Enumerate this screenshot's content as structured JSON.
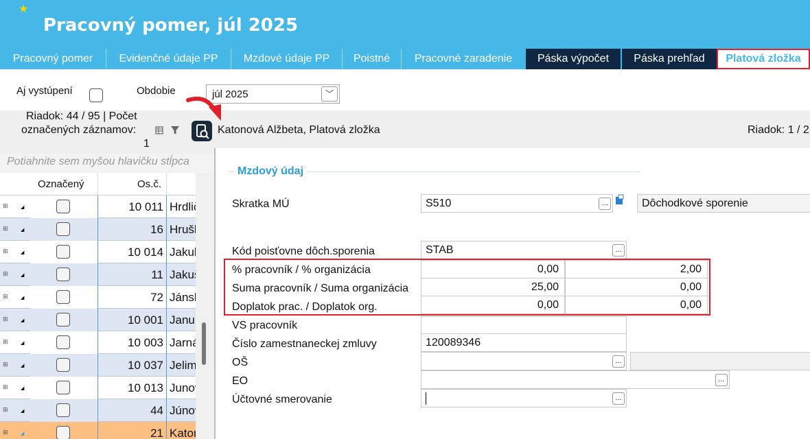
{
  "header": {
    "title": "Pracovný pomer, júl 2025",
    "tabs": [
      {
        "label": "Pracovný pomer"
      },
      {
        "label": "Evidenčné údaje PP"
      },
      {
        "label": "Mzdové údaje PP"
      },
      {
        "label": "Poistné"
      },
      {
        "label": "Pracovné zaradenie"
      },
      {
        "label": "Páska výpočet"
      },
      {
        "label": "Páska prehľad"
      },
      {
        "label": "Platová zložka"
      }
    ]
  },
  "filters": {
    "aj_vystupeni_label": "Aj vystúpení",
    "obdobie_label": "Obdobie",
    "obdobie_value": "júl 2025"
  },
  "grid": {
    "info_line1": "Riadok: 44 / 95 | Počet",
    "info_line2": "označených záznamov:",
    "info_line3": "1",
    "drag_hint": "Potiahnite sem myšou hlavičku stĺpca",
    "col_oznaceny": "Označený",
    "col_osc": "Os.č.",
    "rows": [
      {
        "num": "10 011",
        "name": "Hrdlička"
      },
      {
        "num": "16",
        "name": "Hruška"
      },
      {
        "num": "10 014",
        "name": "Jakubík"
      },
      {
        "num": "11",
        "name": "Jakuš"
      },
      {
        "num": "72",
        "name": "Jánsky"
      },
      {
        "num": "10 001",
        "name": "Janura"
      },
      {
        "num": "10 003",
        "name": "Jarná"
      },
      {
        "num": "10 037",
        "name": "Jelimek"
      },
      {
        "num": "10 013",
        "name": "Junová"
      },
      {
        "num": "44",
        "name": "Júnová"
      },
      {
        "num": "21",
        "name": "Katonová"
      }
    ]
  },
  "detail": {
    "header_title": "Katonová Alžbeta, Platová zložka",
    "row_info": "Riadok: 1 / 2",
    "section_title": "Mzdový údaj",
    "skratka_label": "Skratka MÚ",
    "skratka_value": "S510",
    "skratka_desc": "Dôchodkové sporenie",
    "kod_label": "Kód poisťovne dôch.sporenia",
    "kod_value": "STAB",
    "pct_label": "% pracovník / % organizácia",
    "pct_prac": "0,00",
    "pct_org": "2,00",
    "suma_label": "Suma pracovník / Suma organizácia",
    "suma_prac": "25,00",
    "suma_org": "0,00",
    "dopl_label": "Doplatok prac. / Doplatok org.",
    "dopl_prac": "0,00",
    "dopl_org": "0,00",
    "vs_label": "VS pracovník",
    "zmluva_label": "Číslo zamestnaneckej zmluvy",
    "zmluva_value": "120089346",
    "os_label": "OŠ",
    "eo_label": "EO",
    "uct_label": "Účtovné smerovanie"
  },
  "colors": {
    "header_bg": "#45b8e8",
    "dark_tab": "#0f2743",
    "highlight_red": "#e0202a",
    "selected_row": "#fdbf82",
    "alt_row": "#dde6f2",
    "section_title": "#2a9fd6"
  }
}
